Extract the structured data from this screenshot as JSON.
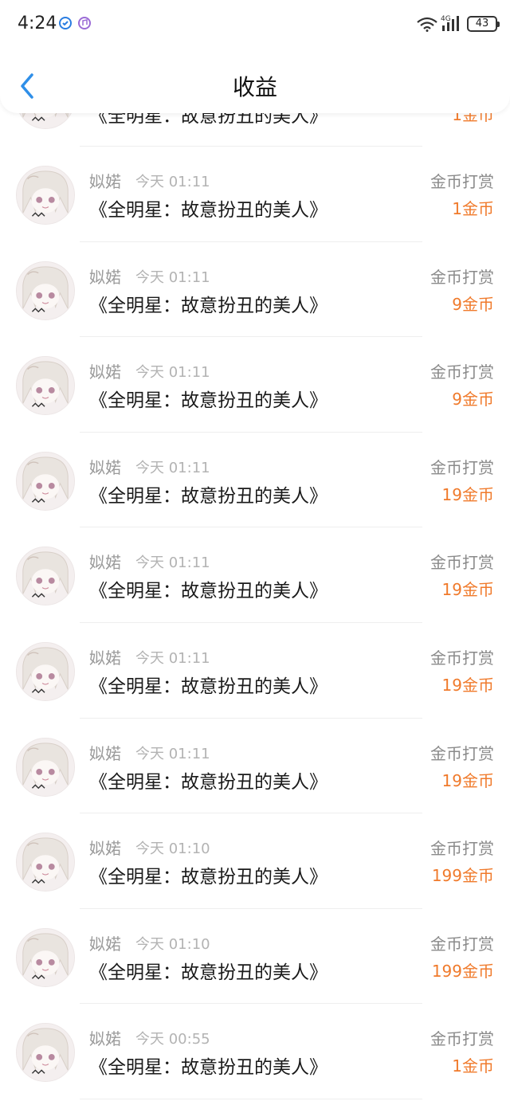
{
  "status_bar": {
    "time": "4:24",
    "network": "4G",
    "battery": "43"
  },
  "header": {
    "title": "收益"
  },
  "partial_row": {
    "title": "《全明星：故意扮丑的美人》",
    "amount": "1金币"
  },
  "rows": [
    {
      "user": "姒婼",
      "time": "今天 01:11",
      "title": "《全明星：故意扮丑的美人》",
      "type": "金币打赏",
      "amount": "1金币"
    },
    {
      "user": "姒婼",
      "time": "今天 01:11",
      "title": "《全明星：故意扮丑的美人》",
      "type": "金币打赏",
      "amount": "9金币"
    },
    {
      "user": "姒婼",
      "time": "今天 01:11",
      "title": "《全明星：故意扮丑的美人》",
      "type": "金币打赏",
      "amount": "9金币"
    },
    {
      "user": "姒婼",
      "time": "今天 01:11",
      "title": "《全明星：故意扮丑的美人》",
      "type": "金币打赏",
      "amount": "19金币"
    },
    {
      "user": "姒婼",
      "time": "今天 01:11",
      "title": "《全明星：故意扮丑的美人》",
      "type": "金币打赏",
      "amount": "19金币"
    },
    {
      "user": "姒婼",
      "time": "今天 01:11",
      "title": "《全明星：故意扮丑的美人》",
      "type": "金币打赏",
      "amount": "19金币"
    },
    {
      "user": "姒婼",
      "time": "今天 01:11",
      "title": "《全明星：故意扮丑的美人》",
      "type": "金币打赏",
      "amount": "19金币"
    },
    {
      "user": "姒婼",
      "time": "今天 01:10",
      "title": "《全明星：故意扮丑的美人》",
      "type": "金币打赏",
      "amount": "199金币"
    },
    {
      "user": "姒婼",
      "time": "今天 01:10",
      "title": "《全明星：故意扮丑的美人》",
      "type": "金币打赏",
      "amount": "199金币"
    },
    {
      "user": "姒婼",
      "time": "今天 00:55",
      "title": "《全明星：故意扮丑的美人》",
      "type": "金币打赏",
      "amount": "1金币"
    }
  ],
  "colors": {
    "accent_orange": "#f07a2b",
    "back_blue": "#2f8fe8"
  }
}
